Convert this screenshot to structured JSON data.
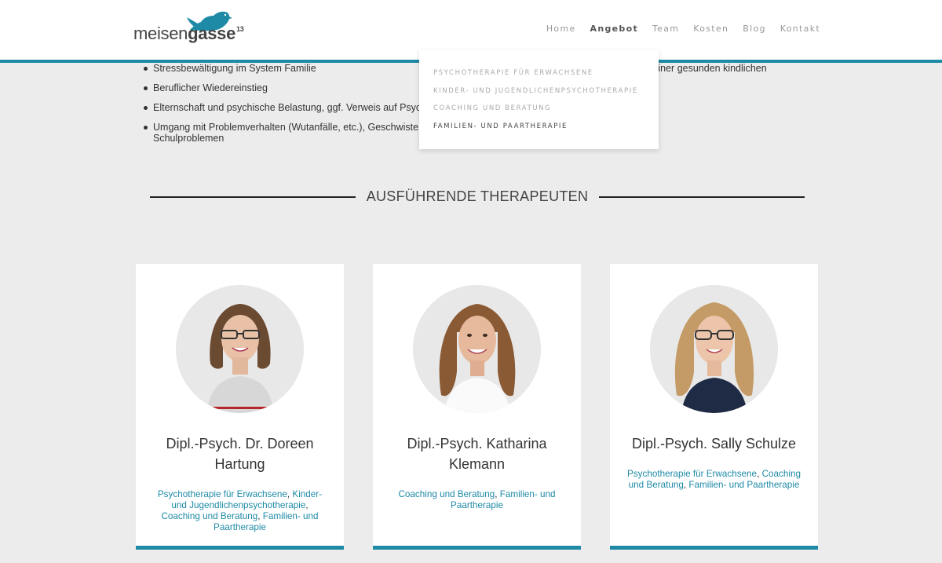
{
  "header": {
    "logo": {
      "word_light": "meisen",
      "word_bold": "gasse",
      "superscript": "13"
    },
    "nav": [
      {
        "label": "Home",
        "active": false
      },
      {
        "label": "Angebot",
        "active": true
      },
      {
        "label": "Team",
        "active": false
      },
      {
        "label": "Kosten",
        "active": false
      },
      {
        "label": "Blog",
        "active": false
      },
      {
        "label": "Kontakt",
        "active": false
      }
    ]
  },
  "dropdown": {
    "items": [
      {
        "label": "PSYCHOTHERAPIE FÜR ERWACHSENE",
        "active": false
      },
      {
        "label": "KINDER- UND JUGENDLICHENPSYCHOTHERAPIE",
        "active": false
      },
      {
        "label": "COACHING UND BERATUNG",
        "active": false
      },
      {
        "label": "FAMILIEN- UND PAARTHERAPIE",
        "active": true
      }
    ]
  },
  "content": {
    "bullets": [
      "Stressbewältigung im System Familie",
      "Beruflicher Wiedereinstieg",
      "Elternschaft und psychische Belastung, ggf. Verweis auf Psycho",
      "Umgang mit Problemverhalten (Wutanfälle, etc.), Geschwisterriv",
      "Schulproblemen"
    ],
    "bullet_right_fragment": "d einer gesunden kindlichen"
  },
  "section": {
    "title": "AUSFÜHRENDE THERAPEUTEN"
  },
  "therapists": [
    {
      "name": "Dipl.-Psych. Dr. Doreen Hartung",
      "tags": [
        "Psychotherapie für Erwachsene",
        "Kinder- und Jugendlichenpsychotherapie",
        "Coaching und Beratung",
        "Familien- und Paartherapie"
      ]
    },
    {
      "name": "Dipl.-Psych. Katharina Klemann",
      "tags": [
        "Coaching und Beratung",
        "Familien- und Paartherapie"
      ]
    },
    {
      "name": "Dipl.-Psych. Sally Schulze",
      "tags": [
        "Psychotherapie für Erwachsene",
        "Coaching und Beratung",
        "Familien- und Paartherapie"
      ]
    }
  ],
  "colors": {
    "accent": "#1e8aa6",
    "background": "#ececec"
  }
}
